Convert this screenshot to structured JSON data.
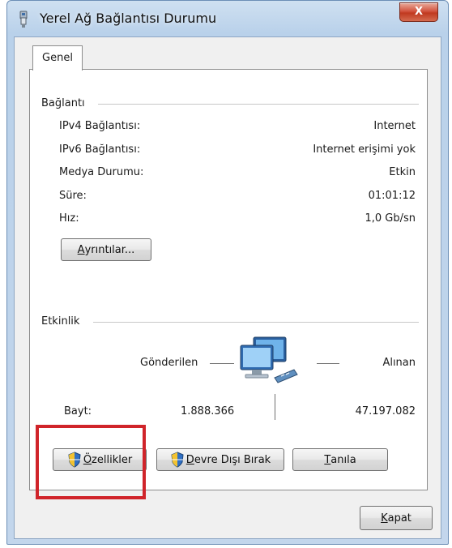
{
  "window": {
    "title": "Yerel Ağ Bağlantısı Durumu",
    "close_label": "X"
  },
  "tabs": [
    {
      "label": "Genel",
      "active": true
    }
  ],
  "connection": {
    "group_label": "Bağlantı",
    "rows": [
      {
        "label": "IPv4 Bağlantısı:",
        "value": "Internet"
      },
      {
        "label": "IPv6 Bağlantısı:",
        "value": "Internet erişimi yok"
      },
      {
        "label": "Medya Durumu:",
        "value": "Etkin"
      },
      {
        "label": "Süre:",
        "value": "01:01:12"
      },
      {
        "label": "Hız:",
        "value": "1,0 Gb/sn"
      }
    ],
    "details_button": {
      "mnemonic": "A",
      "rest": "yrıntılar..."
    }
  },
  "activity": {
    "group_label": "Etkinlik",
    "sent_label": "Gönderilen",
    "received_label": "Alınan",
    "bytes_label": "Bayt:",
    "bytes_sent": "1.888.366",
    "bytes_received": "47.197.082"
  },
  "actions": {
    "properties": {
      "mnemonic": "Ö",
      "rest": "zellikler"
    },
    "disable": {
      "mnemonic": "D",
      "rest": "evre Dışı Bırak"
    },
    "diagnose": {
      "mnemonic": "T",
      "rest": "anıla"
    },
    "close": {
      "mnemonic": "K",
      "rest": "apat"
    }
  },
  "icons": {
    "window_icon": "network-adapter-icon",
    "activity_icon": "network-computers-icon",
    "shield_icon": "uac-shield-icon"
  },
  "colors": {
    "highlight_box": "#d0242a",
    "title_bar": "#b9d1ea",
    "close_button": "#c0391f"
  }
}
